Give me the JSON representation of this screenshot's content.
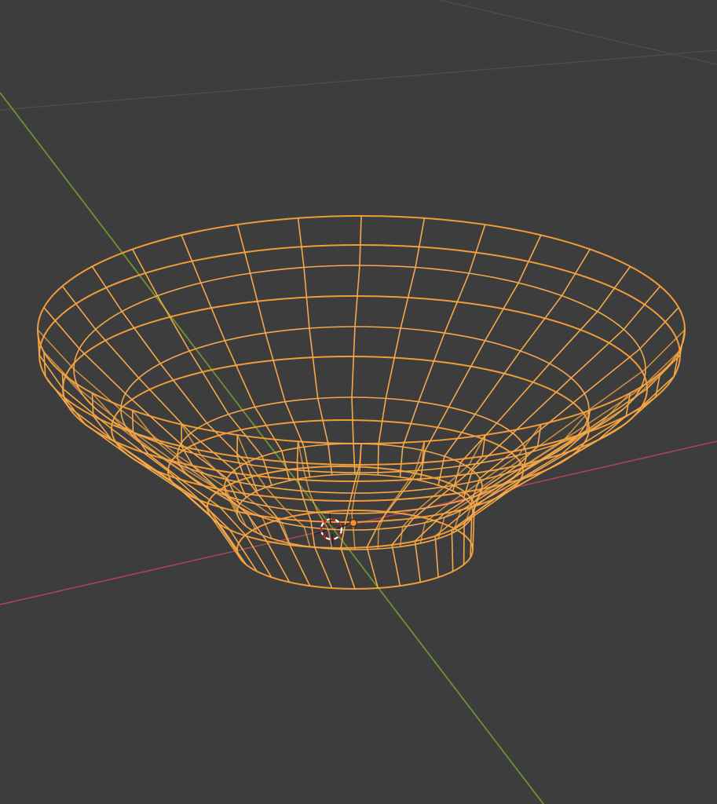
{
  "viewport": {
    "mode": "wireframe",
    "background_color": "#3d3d3d",
    "grid_color": "#4c4c4c",
    "x_axis_color": "#a94655",
    "y_axis_color": "#6e9132"
  },
  "selected_object": {
    "shape": "bowl",
    "display": "wireframe",
    "selection_color": "#f19c38",
    "selected": true
  },
  "gizmos": {
    "cursor_icon": "3d-cursor-icon",
    "origin_icon": "object-origin-icon",
    "origin_color": "#ff8a2a"
  }
}
